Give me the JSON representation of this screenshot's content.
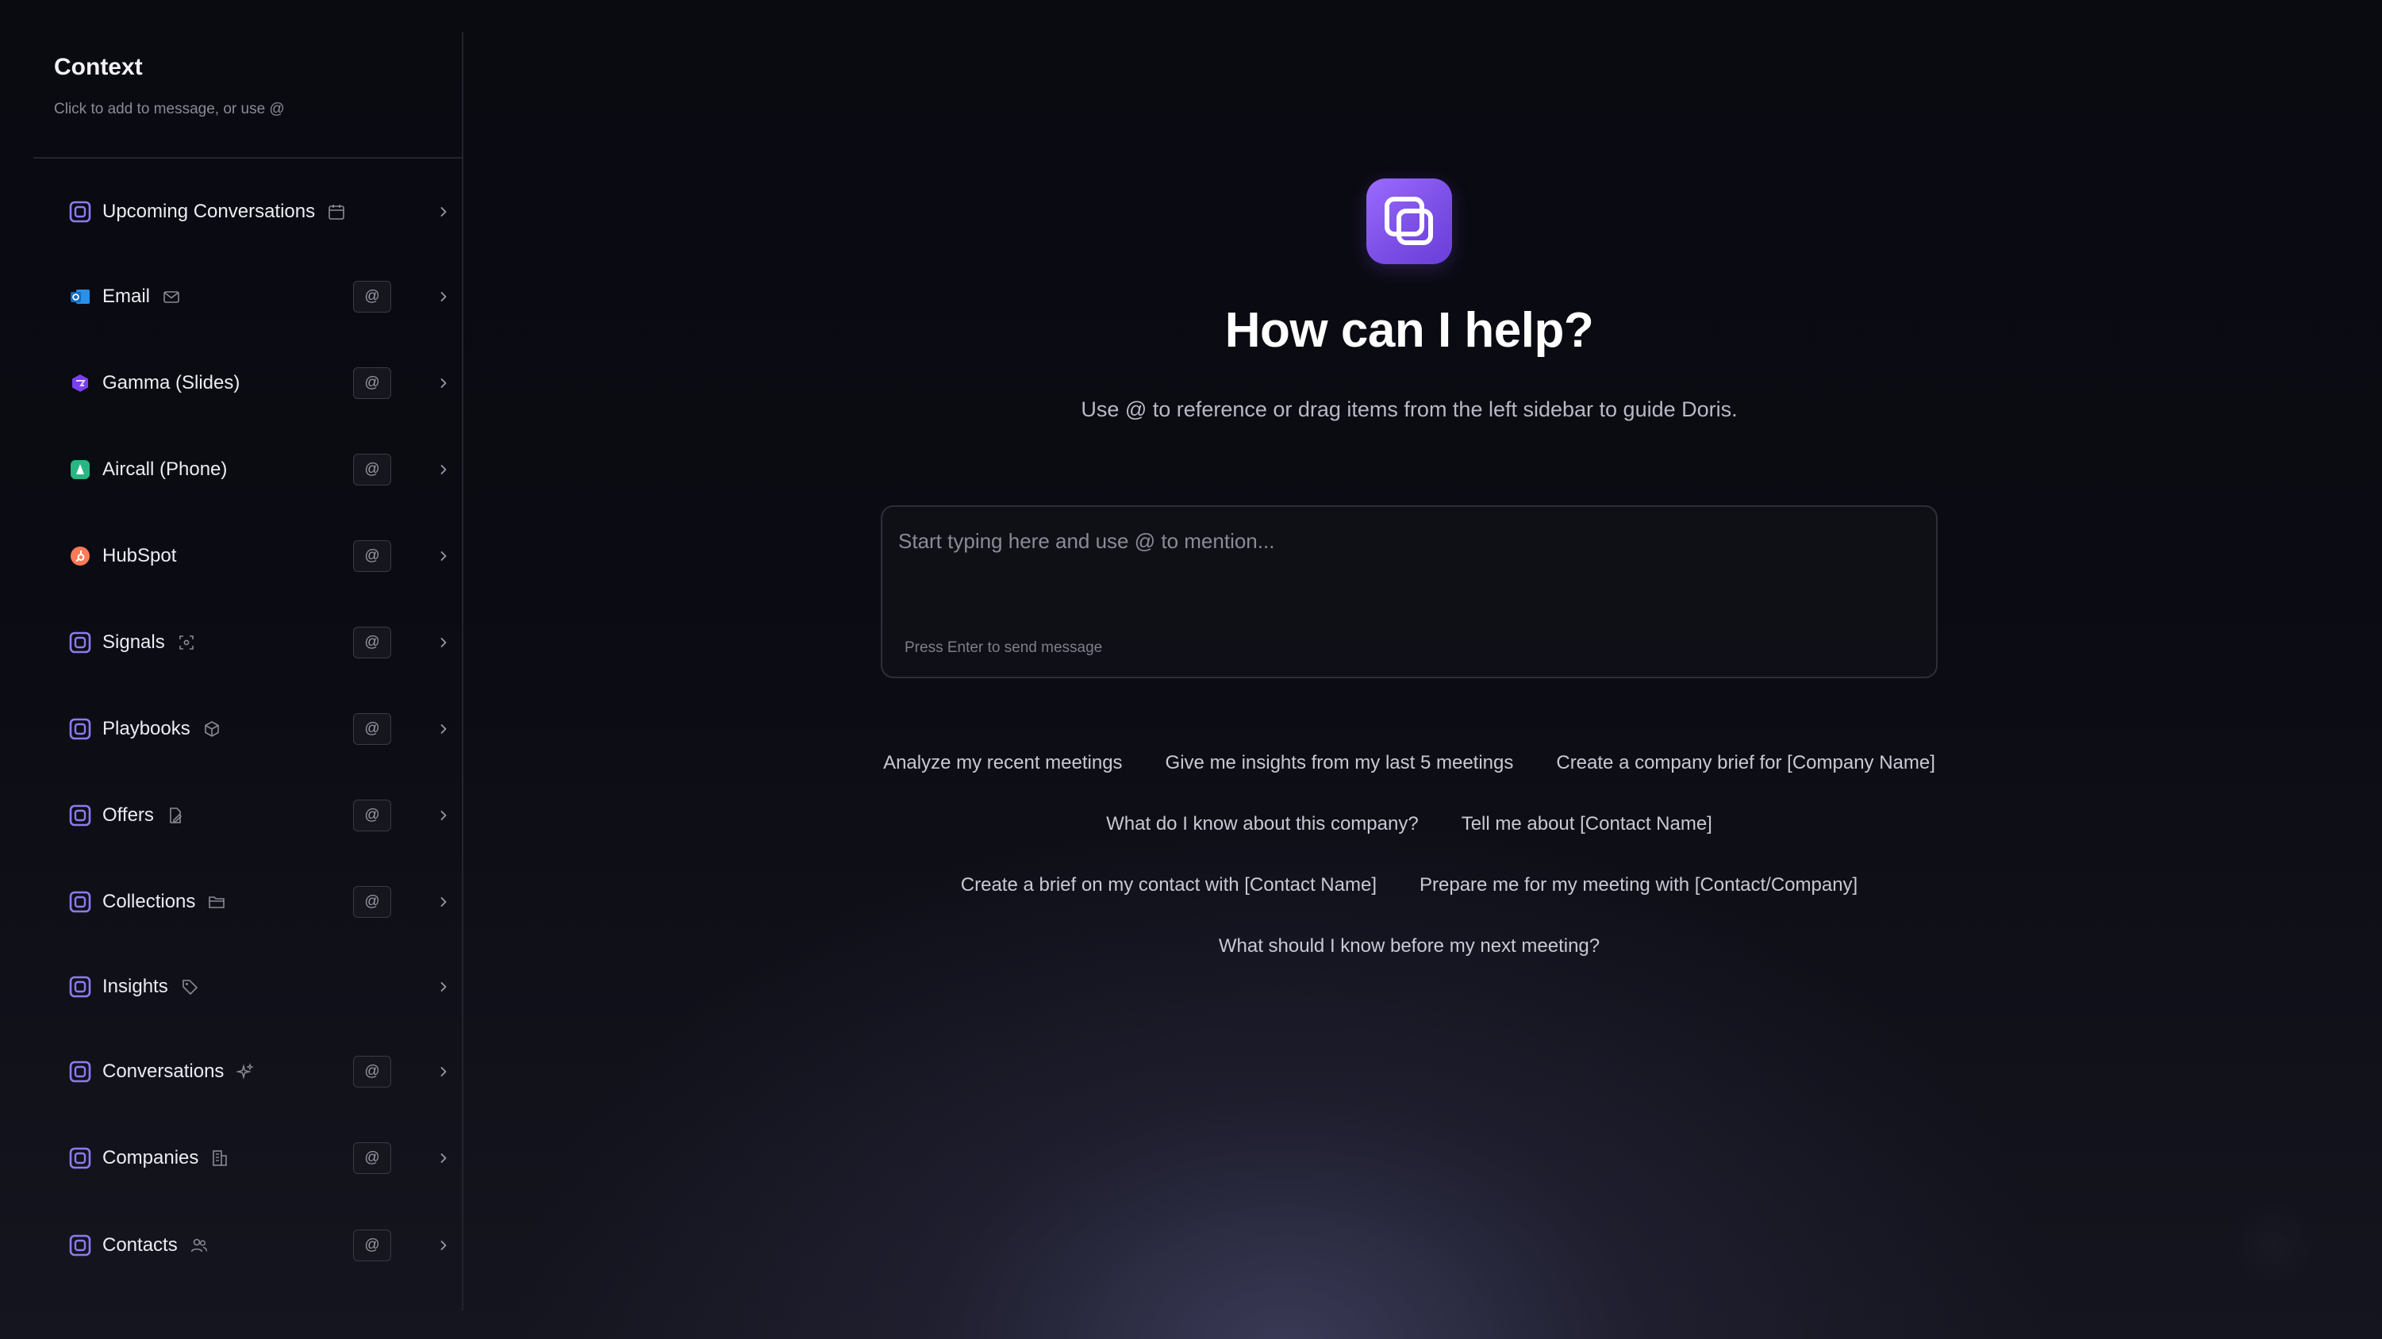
{
  "sidebar": {
    "title": "Context",
    "subtitle": "Click to add to message, or use @",
    "items": [
      {
        "label": "Upcoming Conversations",
        "icon": "doris-square-icon",
        "aux_icon": "calendar-icon",
        "has_at": false
      },
      {
        "label": "Email",
        "icon": "outlook-icon",
        "aux_icon": "mail-icon",
        "has_at": true
      },
      {
        "label": "Gamma (Slides)",
        "icon": "gamma-icon",
        "aux_icon": "",
        "has_at": true
      },
      {
        "label": "Aircall (Phone)",
        "icon": "aircall-icon",
        "aux_icon": "",
        "has_at": true
      },
      {
        "label": "HubSpot",
        "icon": "hubspot-icon",
        "aux_icon": "",
        "has_at": true
      },
      {
        "label": "Signals",
        "icon": "doris-square-icon",
        "aux_icon": "radar-icon",
        "has_at": true
      },
      {
        "label": "Playbooks",
        "icon": "doris-square-icon",
        "aux_icon": "cube-icon",
        "has_at": true
      },
      {
        "label": "Offers",
        "icon": "doris-square-icon",
        "aux_icon": "document-edit-icon",
        "has_at": true
      },
      {
        "label": "Collections",
        "icon": "doris-square-icon",
        "aux_icon": "folder-icon",
        "has_at": true
      },
      {
        "label": "Insights",
        "icon": "doris-square-icon",
        "aux_icon": "tag-icon",
        "has_at": false
      },
      {
        "label": "Conversations",
        "icon": "doris-square-icon",
        "aux_icon": "sparkles-icon",
        "has_at": true
      },
      {
        "label": "Companies",
        "icon": "doris-square-icon",
        "aux_icon": "building-icon",
        "has_at": true
      },
      {
        "label": "Contacts",
        "icon": "doris-square-icon",
        "aux_icon": "users-icon",
        "has_at": true
      }
    ],
    "at_label": "@"
  },
  "main": {
    "logo_icon": "doris-logo-icon",
    "heading": "How can I help?",
    "subheading": "Use @ to reference or drag items from the left sidebar to guide Doris.",
    "composer": {
      "placeholder": "Start typing here and use @ to mention...",
      "hint": "Press Enter to send message"
    },
    "suggestions": [
      [
        "Analyze my recent meetings",
        "Give me insights from my last 5 meetings",
        "Create a company brief for [Company Name]"
      ],
      [
        "What do I know about this company?",
        "Tell me about [Contact Name]"
      ],
      [
        "Create a brief on my contact with [Contact Name]",
        "Prepare me for my meeting with [Contact/Company]"
      ],
      [
        "What should I know before my next meeting?"
      ]
    ]
  },
  "colors": {
    "accent": "#8b5cf6",
    "background": "#0b0b12",
    "sidebar_border": "#24242e"
  }
}
